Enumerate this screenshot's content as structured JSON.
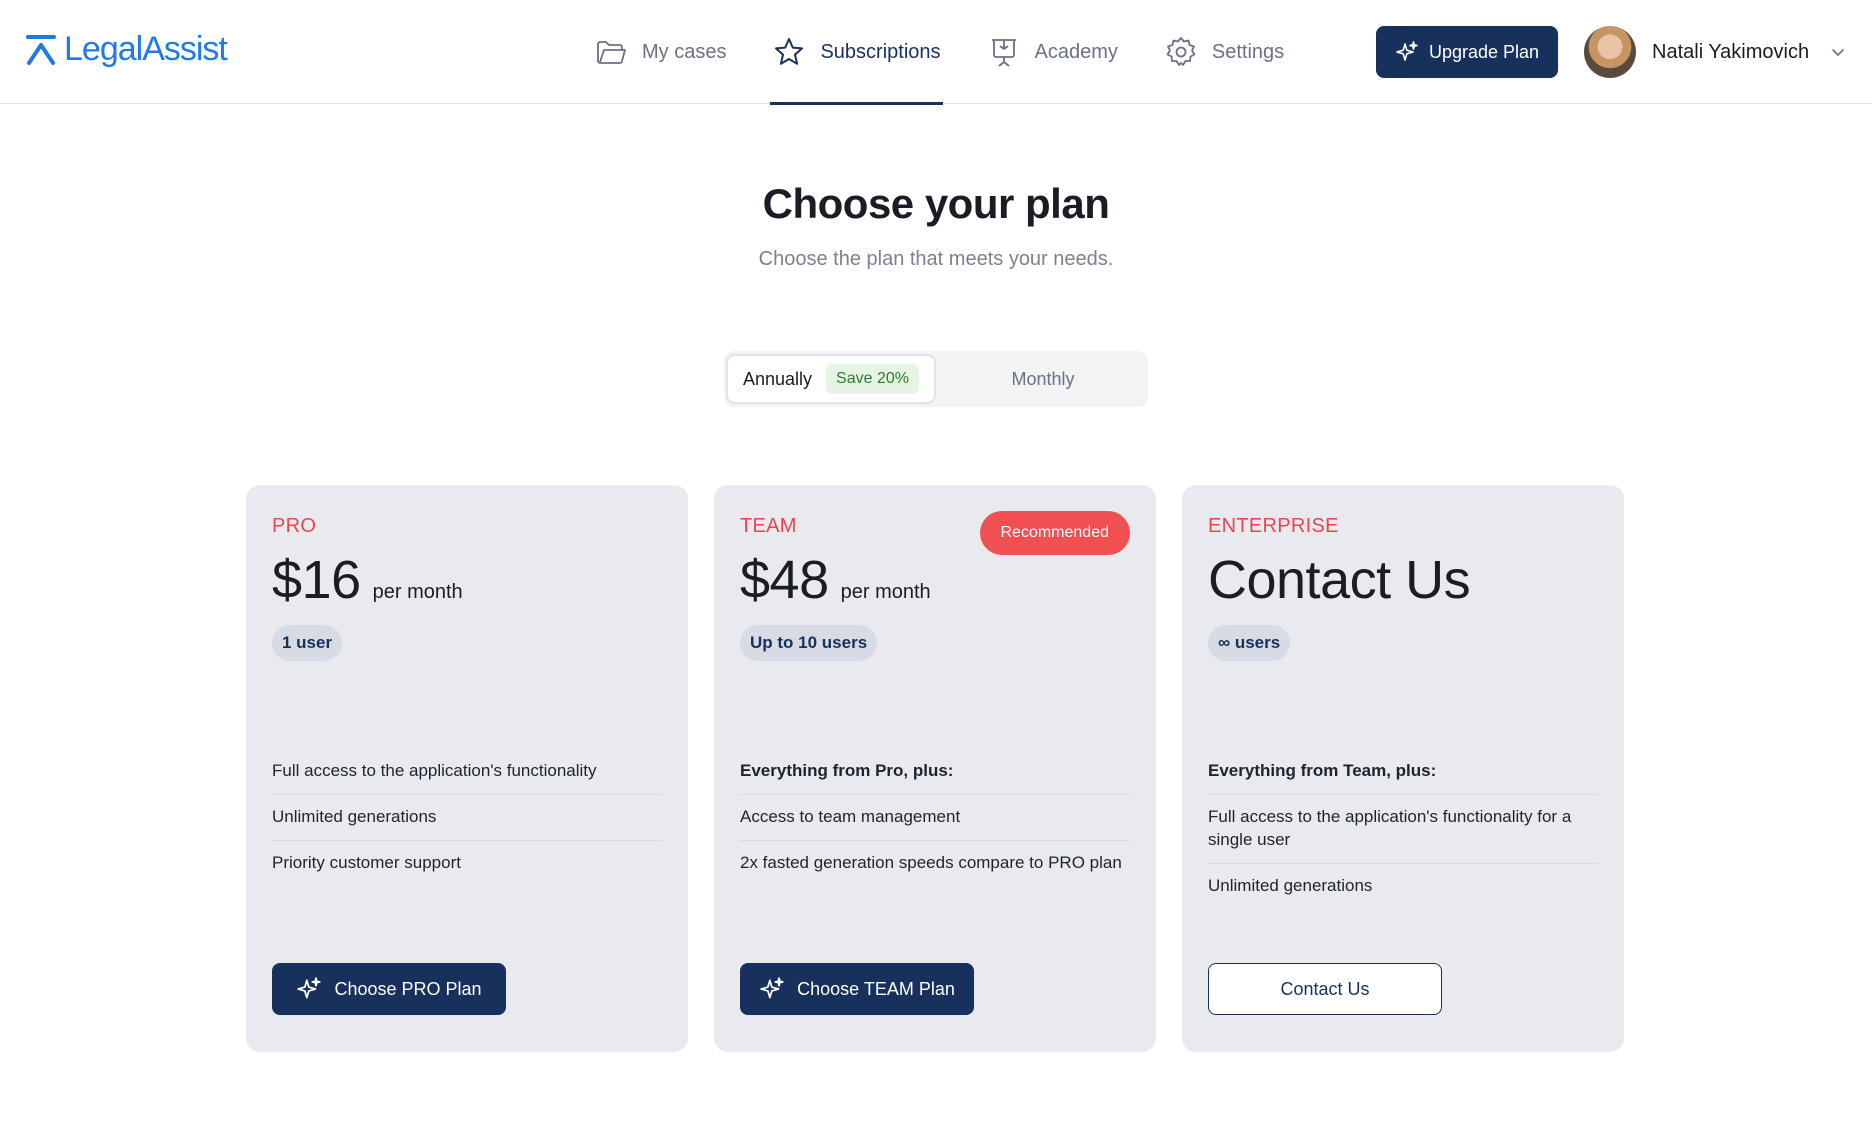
{
  "header": {
    "logo_text": "LegalAssist",
    "nav": [
      {
        "label": "My cases",
        "icon": "folder-icon"
      },
      {
        "label": "Subscriptions",
        "icon": "star-icon",
        "active": true
      },
      {
        "label": "Academy",
        "icon": "presentation-icon"
      },
      {
        "label": "Settings",
        "icon": "gear-icon"
      }
    ],
    "upgrade_label": "Upgrade Plan",
    "user_name": "Natali Yakimovich"
  },
  "hero": {
    "title": "Choose your plan",
    "subtitle": "Choose the plan that meets your needs."
  },
  "billing_toggle": {
    "annually_label": "Annually",
    "save_badge": "Save 20%",
    "monthly_label": "Monthly",
    "selected": "Annually"
  },
  "plans": [
    {
      "name": "PRO",
      "price": "$16",
      "period": "per month",
      "users": "1 user",
      "features": [
        "Full access to the application's functionality",
        "Unlimited generations",
        "Priority customer support"
      ],
      "button_label": "Choose PRO Plan"
    },
    {
      "name": "TEAM",
      "badge": "Recommended",
      "price": "$48",
      "period": "per month",
      "users": "Up to 10 users",
      "features": [
        "Everything from Pro, plus:",
        "Access to team management",
        "2x fasted generation speeds compare to PRO plan"
      ],
      "button_label": "Choose TEAM Plan"
    },
    {
      "name": "ENTERPRISE",
      "price": "Contact Us",
      "users": "∞ users",
      "features": [
        "Everything from Team, plus:",
        "Full access to the application's functionality for a single user",
        "Unlimited generations"
      ],
      "button_label": "Contact Us"
    }
  ],
  "colors": {
    "primary": "#17305c",
    "accent": "#1f7ae6",
    "plan_name": "#e9464f",
    "recommended": "#f05052",
    "card_bg": "#e8eaef"
  }
}
